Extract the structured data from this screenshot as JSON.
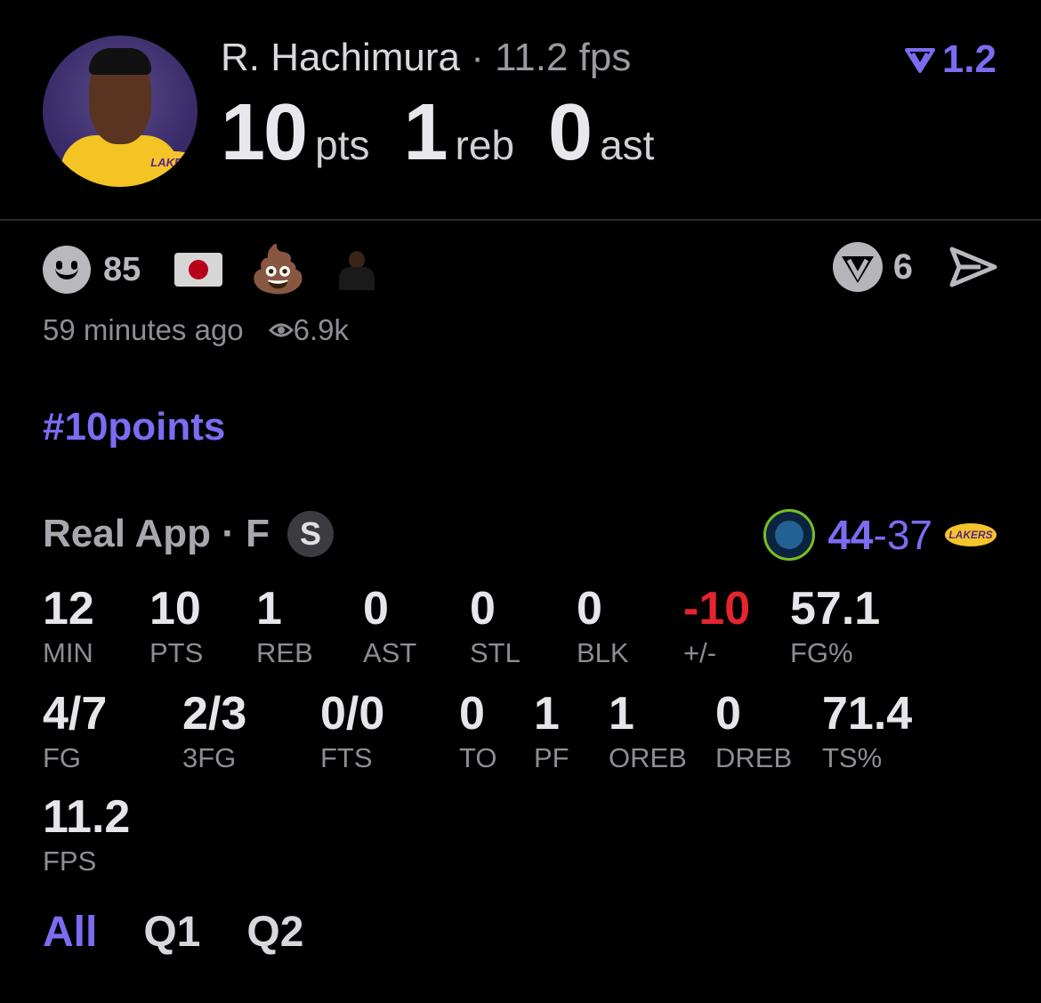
{
  "player": {
    "name": "R. Hachimura",
    "fps_label": "· 11.2 fps",
    "boost": "1.2",
    "pts": "10",
    "pts_unit": "pts",
    "reb": "1",
    "reb_unit": "reb",
    "ast": "0",
    "ast_unit": "ast",
    "team_logo_text": "LAKERS"
  },
  "social": {
    "reaction_count": "85",
    "share_count": "6",
    "time_ago": "59 minutes ago",
    "views": "6.9k"
  },
  "hashtag": "#10points",
  "game": {
    "source": "Real App",
    "position": "· F",
    "badge": "S",
    "home_score": "44",
    "separator": "-",
    "away_score": "37",
    "away_logo_text": "LAKERS"
  },
  "stats_row1": [
    {
      "v": "12",
      "l": "MIN"
    },
    {
      "v": "10",
      "l": "PTS"
    },
    {
      "v": "1",
      "l": "REB"
    },
    {
      "v": "0",
      "l": "AST"
    },
    {
      "v": "0",
      "l": "STL"
    },
    {
      "v": "0",
      "l": "BLK"
    },
    {
      "v": "-10",
      "l": "+/-"
    },
    {
      "v": "57.1",
      "l": "FG%"
    }
  ],
  "stats_row2": [
    {
      "v": "4/7",
      "l": "FG"
    },
    {
      "v": "2/3",
      "l": "3FG"
    },
    {
      "v": "0/0",
      "l": "FTS"
    },
    {
      "v": "0",
      "l": "TO"
    },
    {
      "v": "1",
      "l": "PF"
    },
    {
      "v": "1",
      "l": "OREB"
    },
    {
      "v": "0",
      "l": "DREB"
    },
    {
      "v": "71.4",
      "l": "TS%"
    }
  ],
  "stats_row3": [
    {
      "v": "11.2",
      "l": "FPS"
    }
  ],
  "tabs": [
    "All",
    "Q1",
    "Q2"
  ],
  "colors": {
    "accent": "#7c6cf2",
    "negative": "#e5252d",
    "background": "#000000"
  },
  "icons": [
    "smiley-icon",
    "japan-flag-icon",
    "poop-emoji-icon",
    "person-emoji-icon",
    "v-logo-icon",
    "send-icon",
    "eye-icon",
    "boost-icon"
  ]
}
